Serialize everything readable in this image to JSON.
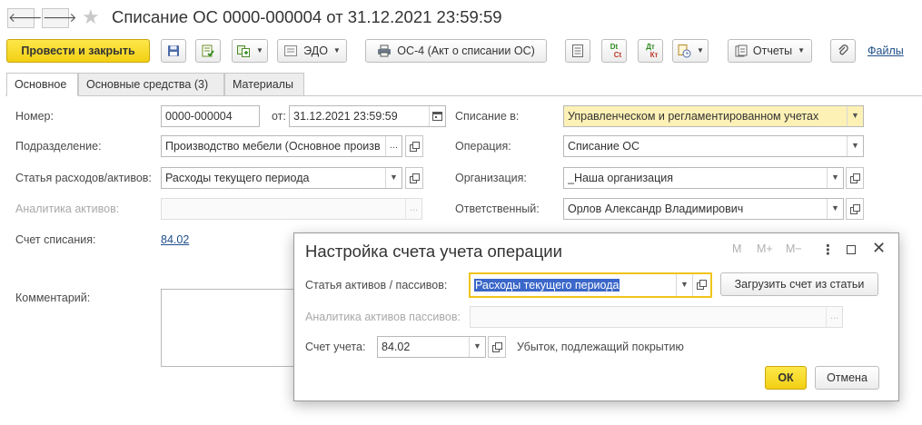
{
  "window": {
    "title": "Списание ОС 0000-000004 от 31.12.2021 23:59:59",
    "back_glyph": "🡐",
    "forward_glyph": "🡒"
  },
  "toolbar": {
    "post_close_label": "Провести и закрыть",
    "edo_label": "ЭДО",
    "print_label": "ОС-4 (Акт о списании ОС)",
    "dtkt_top": "Dt",
    "dtkt_bottom": "Ct",
    "dtkt2_top": "Дт",
    "dtkt2_bottom": "Кт",
    "reports_label": "Отчеты",
    "files_label": "Файлы"
  },
  "tabs": [
    {
      "label": "Основное",
      "active": true
    },
    {
      "label": "Основные средства (3)",
      "active": false
    },
    {
      "label": "Материалы",
      "active": false
    }
  ],
  "form": {
    "number_label": "Номер:",
    "number_value": "0000-000004",
    "from_label": "от:",
    "date_value": "31.12.2021 23:59:59",
    "writeoff_in_label": "Списание в:",
    "writeoff_in_value": "Управленческом и регламентированном учетах",
    "division_label": "Подразделение:",
    "division_value": "Производство мебели (Основное произв",
    "operation_label": "Операция:",
    "operation_value": "Списание ОС",
    "expense_item_label": "Статья расходов/активов:",
    "expense_item_value": "Расходы текущего периода",
    "organization_label": "Организация:",
    "organization_value": "_Наша организация",
    "asset_analytics_label": "Аналитика активов:",
    "responsible_label": "Ответственный:",
    "responsible_value": "Орлов Александр Владимирович",
    "writeoff_account_label": "Счет списания:",
    "writeoff_account_value": "84.02",
    "comment_label": "Комментарий:",
    "ellipsis": "..."
  },
  "dialog": {
    "title": "Настройка счета учета операции",
    "m_label": "M",
    "mplus_label": "M+",
    "mminus_label": "M−",
    "more_glyph": "⋮",
    "item_label": "Статья активов / пассивов:",
    "item_value": "Расходы текущего периода",
    "load_button": "Загрузить счет из статьи",
    "analytics_label": "Аналитика активов пассивов:",
    "account_label": "Счет учета:",
    "account_value": "84.02",
    "account_description": "Убыток, подлежащий покрытию",
    "ok_label": "ОК",
    "cancel_label": "Отмена",
    "ellipsis": "..."
  }
}
